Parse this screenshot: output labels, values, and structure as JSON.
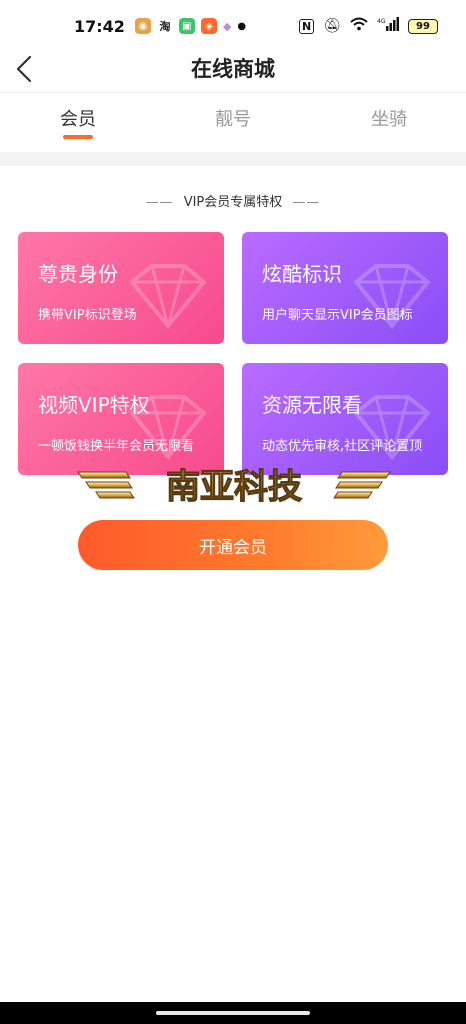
{
  "status_bar": {
    "time": "17:42",
    "nfc": "N",
    "network": "4G",
    "battery": "99"
  },
  "header": {
    "title": "在线商城",
    "back_icon": "chevron-left-icon"
  },
  "tabs": [
    {
      "label": "会员",
      "active": true
    },
    {
      "label": "靓号",
      "active": false
    },
    {
      "label": "坐骑",
      "active": false
    }
  ],
  "section": {
    "title": "VIP会员专属特权",
    "dash": "——"
  },
  "cards": [
    {
      "title": "尊贵身份",
      "desc": "携带VIP标识登场",
      "color": "#f64a8d"
    },
    {
      "title": "炫酷标识",
      "desc": "用户聊天显示VIP会员图标",
      "color": "#8a4ef6"
    },
    {
      "title": "视频VIP特权",
      "desc": "一顿饭钱换半年会员无限看",
      "color": "#f64a8d"
    },
    {
      "title": "资源无限看",
      "desc": "动态优先审核,社区评论置顶",
      "color": "#8a4ef6"
    }
  ],
  "watermark": "南亚科技",
  "cta": {
    "label": "开通会员",
    "color": "#ff6a2b"
  }
}
